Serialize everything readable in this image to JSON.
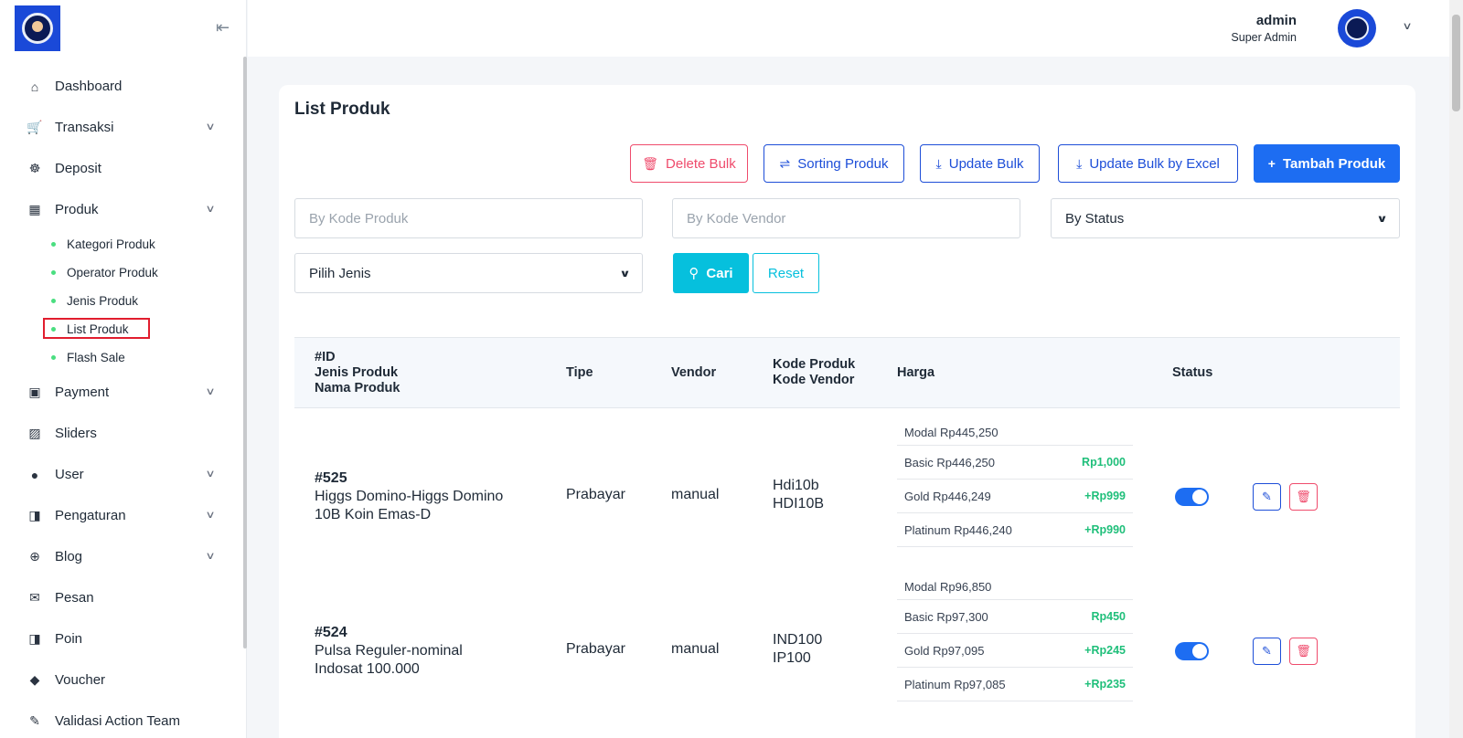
{
  "sidebar": {
    "items": [
      {
        "label": "Dashboard",
        "icon": "home-icon",
        "glyph": "⌂",
        "has_children": false
      },
      {
        "label": "Transaksi",
        "icon": "cart-icon",
        "glyph": "🛒",
        "has_children": true
      },
      {
        "label": "Deposit",
        "icon": "deposit-icon",
        "glyph": "☸",
        "has_children": false
      },
      {
        "label": "Produk",
        "icon": "store-icon",
        "glyph": "▦",
        "has_children": true
      }
    ],
    "submenu": [
      {
        "label": "Kategori Produk",
        "active": false
      },
      {
        "label": "Operator Produk",
        "active": false
      },
      {
        "label": "Jenis Produk",
        "active": false
      },
      {
        "label": "List Produk",
        "active": true
      },
      {
        "label": "Flash Sale",
        "active": false
      }
    ],
    "items_after": [
      {
        "label": "Payment",
        "icon": "wallet-icon",
        "glyph": "▣",
        "has_children": true
      },
      {
        "label": "Sliders",
        "icon": "image-icon",
        "glyph": "▨",
        "has_children": false
      },
      {
        "label": "User",
        "icon": "user-icon",
        "glyph": "●",
        "has_children": true
      },
      {
        "label": "Pengaturan",
        "icon": "settings-icon",
        "glyph": "◨",
        "has_children": true
      },
      {
        "label": "Blog",
        "icon": "globe-icon",
        "glyph": "⊕",
        "has_children": true
      },
      {
        "label": "Pesan",
        "icon": "mail-icon",
        "glyph": "✉",
        "has_children": false
      },
      {
        "label": "Poin",
        "icon": "points-icon",
        "glyph": "◨",
        "has_children": false
      },
      {
        "label": "Voucher",
        "icon": "tag-icon",
        "glyph": "◆",
        "has_children": false
      },
      {
        "label": "Validasi Action Team",
        "icon": "brush-icon",
        "glyph": "✎",
        "has_children": false
      }
    ]
  },
  "header": {
    "user_name": "admin",
    "user_role": "Super Admin"
  },
  "page": {
    "title": "List Produk",
    "buttons": {
      "delete_bulk": "Delete Bulk",
      "sorting": "Sorting Produk",
      "update_bulk": "Update Bulk",
      "update_excel": "Update Bulk by Excel",
      "add": "Tambah Produk"
    },
    "filters": {
      "kode_produk_placeholder": "By Kode Produk",
      "kode_vendor_placeholder": "By Kode Vendor",
      "status_selected": "By Status",
      "jenis_selected": "Pilih Jenis",
      "search_label": "Cari",
      "reset_label": "Reset"
    }
  },
  "table": {
    "headers": {
      "id_line1": "#ID",
      "id_line2": "Jenis Produk",
      "id_line3": "Nama Produk",
      "tipe": "Tipe",
      "vendor": "Vendor",
      "kode_line1": "Kode Produk",
      "kode_line2": "Kode Vendor",
      "harga": "Harga",
      "status": "Status"
    },
    "rows": [
      {
        "id": "#525",
        "name_line1": "Higgs Domino-Higgs Domino",
        "name_line2": "10B Koin Emas-D",
        "tipe": "Prabayar",
        "vendor": "manual",
        "kode_produk": "Hdi10b",
        "kode_vendor": "HDI10B",
        "prices": [
          {
            "label": "Modal Rp445,250",
            "markup": ""
          },
          {
            "label": "Basic Rp446,250",
            "markup": "Rp1,000"
          },
          {
            "label": "Gold Rp446,249",
            "markup": "+Rp999"
          },
          {
            "label": "Platinum Rp446,240",
            "markup": "+Rp990"
          }
        ],
        "status_on": true
      },
      {
        "id": "#524",
        "name_line1": "Pulsa Reguler-nominal",
        "name_line2": "Indosat 100.000",
        "tipe": "Prabayar",
        "vendor": "manual",
        "kode_produk": "IND100",
        "kode_vendor": "IP100",
        "prices": [
          {
            "label": "Modal Rp96,850",
            "markup": ""
          },
          {
            "label": "Basic Rp97,300",
            "markup": "Rp450"
          },
          {
            "label": "Gold Rp97,095",
            "markup": "+Rp245"
          },
          {
            "label": "Platinum Rp97,085",
            "markup": "+Rp235"
          }
        ],
        "status_on": true
      }
    ]
  },
  "colors": {
    "primary": "#1d6df2",
    "info": "#06c0dd",
    "danger": "#ef4b6c",
    "success": "#1fbf7a"
  }
}
